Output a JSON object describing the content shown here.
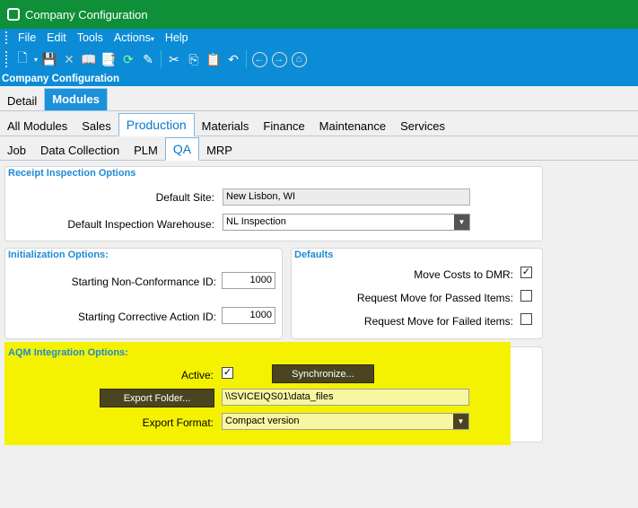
{
  "window": {
    "title": "Company Configuration"
  },
  "menu": [
    "File",
    "Edit",
    "Tools",
    "Actions",
    "Help"
  ],
  "header": {
    "title": "Company Configuration"
  },
  "tabs_l1": [
    {
      "label": "Detail",
      "active": false
    },
    {
      "label": "Modules",
      "active": true
    }
  ],
  "tabs_l2": [
    {
      "label": "All Modules"
    },
    {
      "label": "Sales"
    },
    {
      "label": "Production",
      "active": true
    },
    {
      "label": "Materials"
    },
    {
      "label": "Finance"
    },
    {
      "label": "Maintenance"
    },
    {
      "label": "Services"
    }
  ],
  "tabs_l3": [
    {
      "label": "Job"
    },
    {
      "label": "Data Collection"
    },
    {
      "label": "PLM"
    },
    {
      "label": "QA",
      "active": true
    },
    {
      "label": "MRP"
    }
  ],
  "receipt": {
    "title": "Receipt Inspection Options",
    "default_site_label": "Default Site:",
    "default_site_value": "New Lisbon, WI",
    "warehouse_label": "Default Inspection Warehouse:",
    "warehouse_value": "NL Inspection"
  },
  "init": {
    "title": "Initialization Options:",
    "ncr_label": "Starting Non-Conformance ID:",
    "ncr_value": "1000",
    "ca_label": "Starting Corrective Action ID:",
    "ca_value": "1000"
  },
  "defaults": {
    "title": "Defaults",
    "move_costs_label": "Move Costs to DMR:",
    "move_costs_checked": true,
    "passed_label": "Request Move for Passed Items:",
    "passed_checked": false,
    "failed_label": "Request Move for Failed items:",
    "failed_checked": false
  },
  "aqm": {
    "title": "AQM Integration Options:",
    "active_label": "Active:",
    "active_checked": true,
    "sync_label": "Synchronize...",
    "export_folder_label": "Export Folder...",
    "export_folder_value": "\\\\SVICEIQS01\\data_files",
    "export_format_label": "Export Format:",
    "export_format_value": "Compact version"
  },
  "colors": {
    "title_bar": "#0f8f38",
    "menu_bar": "#0c8cd6",
    "highlight": "#f4f200",
    "group_title": "#1e8ad6"
  }
}
